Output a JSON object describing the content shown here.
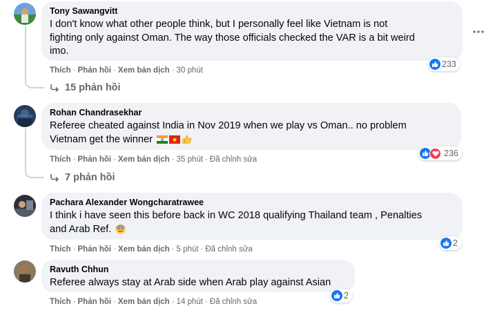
{
  "comments": [
    {
      "author": "Tony Sawangvitt",
      "lines": [
        "I don't know what other people think, but I personally feel like Vietnam is not",
        "fighting only against Oman. The way those officials checked the VAR is a bit weird",
        "imo."
      ],
      "actions": {
        "like": "Thích",
        "reply": "Phản hồi",
        "translate": "Xem bản dịch",
        "time": "30 phút",
        "edited": ""
      },
      "reactions": {
        "count": "233",
        "types": [
          "like-icon"
        ]
      },
      "replies": "15 phản hồi"
    },
    {
      "author": "Rohan Chandrasekhar",
      "lines": [
        "Referee cheated against India in Nov 2019 when we play vs Oman.. no problem",
        "Vietnam get the winner"
      ],
      "emoji": [
        "india-flag-icon",
        "vietnam-flag-icon",
        "thumbs-up-emoji-icon"
      ],
      "actions": {
        "like": "Thích",
        "reply": "Phản hồi",
        "translate": "Xem bản dịch",
        "time": "35 phút",
        "edited": "Đã chỉnh sửa"
      },
      "reactions": {
        "count": "236",
        "types": [
          "like-icon",
          "love-icon"
        ]
      },
      "replies": "7 phản hồi"
    },
    {
      "author": "Pachara Alexander Wongcharatrawee",
      "lines": [
        "I think i have seen this before back in WC 2018 qualifying Thailand team , Penalties",
        "and Arab Ref."
      ],
      "emoji": [
        "anxious-face-emoji-icon"
      ],
      "actions": {
        "like": "Thích",
        "reply": "Phản hồi",
        "translate": "Xem bản dịch",
        "time": "5 phút",
        "edited": "Đã chỉnh sửa"
      },
      "reactions": {
        "count": "2",
        "types": [
          "like-icon"
        ]
      }
    },
    {
      "author": "Ravuth Chhun",
      "lines": [
        "Referee always stay at Arab side when Arab play against Asian"
      ],
      "actions": {
        "like": "Thích",
        "reply": "Phản hồi",
        "translate": "Xem bản dịch",
        "time": "14 phút",
        "edited": "Đã chỉnh sửa"
      },
      "reactions": {
        "count": "2",
        "types": [
          "like-icon"
        ]
      }
    }
  ],
  "colors": {
    "bubble": "#f0f2f5",
    "like": "#1877f2",
    "love": "#f33e58",
    "muted": "#65676b"
  }
}
